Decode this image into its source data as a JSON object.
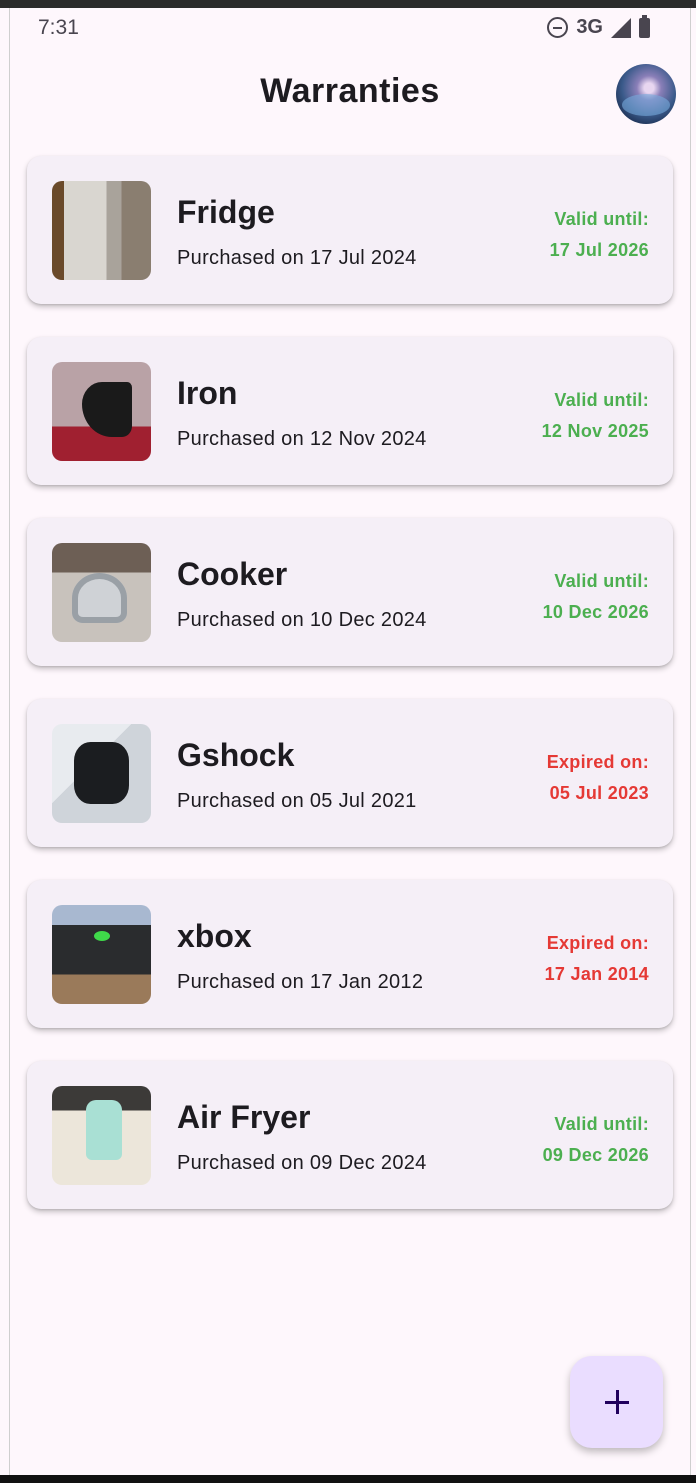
{
  "status_bar": {
    "time": "7:31",
    "network": "3G"
  },
  "app_bar": {
    "title": "Warranties"
  },
  "warranties": [
    {
      "name": "Fridge",
      "purchased": "Purchased on 17 Jul 2024",
      "status_label": "Valid until:",
      "status_date": "17 Jul 2026",
      "status": "valid"
    },
    {
      "name": "Iron",
      "purchased": "Purchased on 12 Nov 2024",
      "status_label": "Valid until:",
      "status_date": "12 Nov 2025",
      "status": "valid"
    },
    {
      "name": "Cooker",
      "purchased": "Purchased on 10 Dec 2024",
      "status_label": "Valid until:",
      "status_date": "10 Dec 2026",
      "status": "valid"
    },
    {
      "name": "Gshock",
      "purchased": "Purchased on 05 Jul 2021",
      "status_label": "Expired on:",
      "status_date": "05 Jul 2023",
      "status": "expired"
    },
    {
      "name": "xbox",
      "purchased": "Purchased on 17 Jan 2012",
      "status_label": "Expired on:",
      "status_date": "17 Jan 2014",
      "status": "expired"
    },
    {
      "name": "Air Fryer",
      "purchased": "Purchased on 09 Dec 2024",
      "status_label": "Valid until:",
      "status_date": "09 Dec 2026",
      "status": "valid"
    }
  ],
  "colors": {
    "valid": "#4caf50",
    "expired": "#e53935",
    "fab_bg": "#eaddff",
    "background": "#fef7fc",
    "card": "#f5eff7"
  },
  "fab": {
    "icon": "plus-icon"
  }
}
